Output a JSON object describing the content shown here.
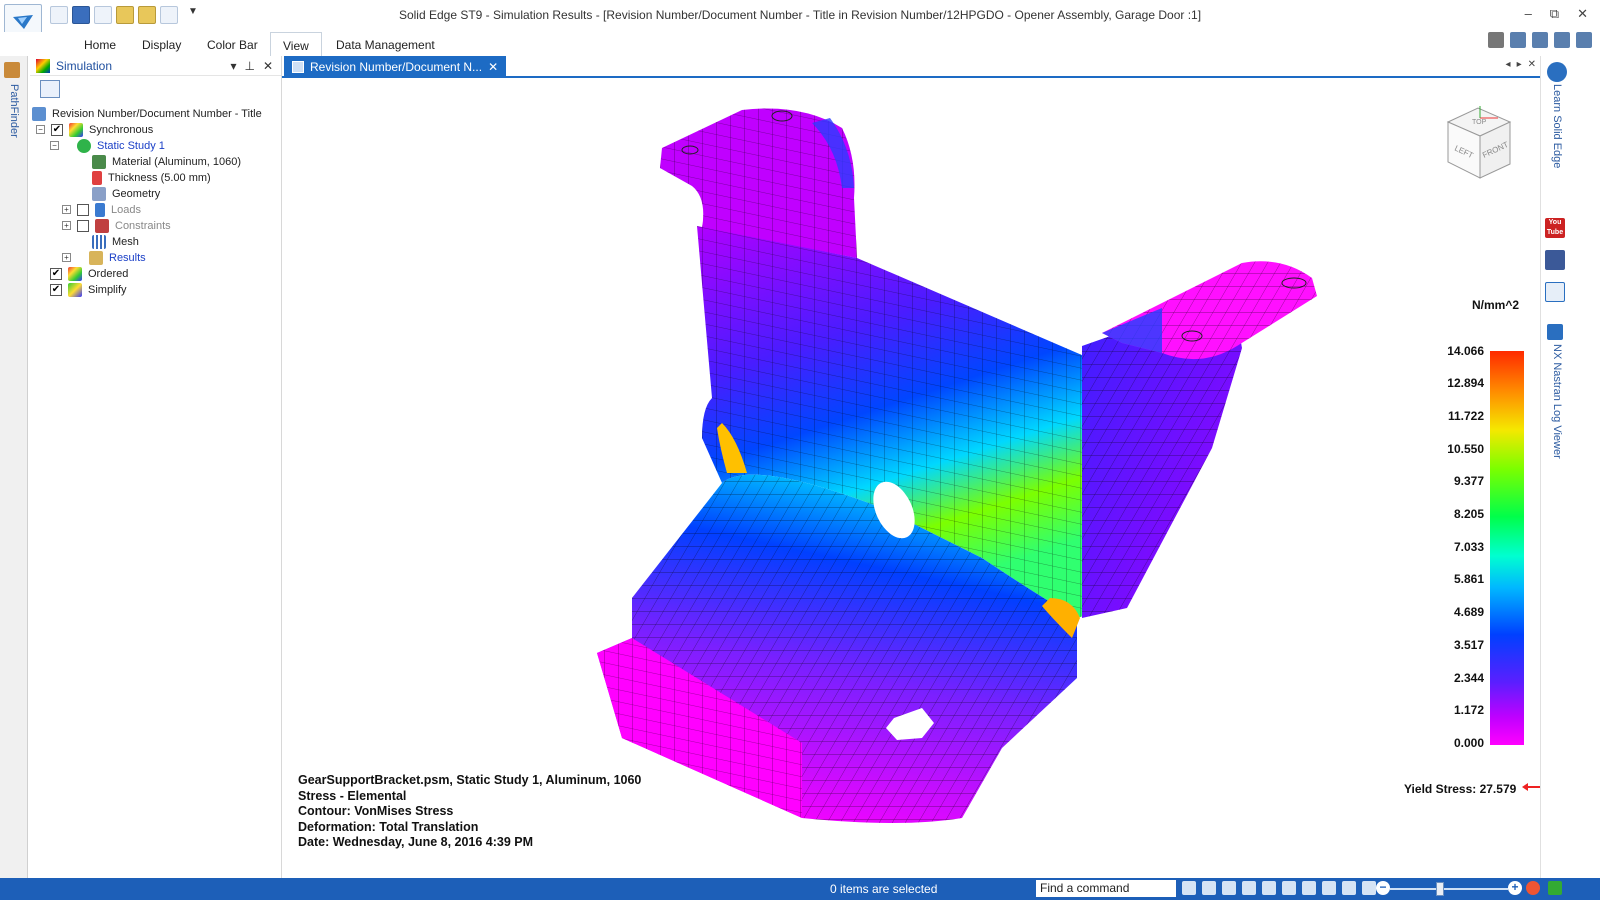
{
  "window": {
    "title": "Solid Edge ST9 - Simulation Results - [Revision Number/Document Number - Title in Revision Number/12HPGDO - Opener Assembly, Garage Door :1]",
    "controls": [
      "–",
      "⧉",
      "✕"
    ]
  },
  "ribbon": {
    "tabs": [
      "Home",
      "Display",
      "Color Bar",
      "View",
      "Data Management"
    ],
    "active_tab": "View"
  },
  "left_strip": {
    "label": "PathFinder"
  },
  "panel": {
    "title": "Simulation",
    "controls": [
      "▾",
      "⊥",
      "✕"
    ],
    "tree": [
      {
        "label": "Revision Number/Document Number - Title",
        "level": 0
      },
      {
        "label": "Synchronous",
        "level": 1,
        "checked": true,
        "expander": "−"
      },
      {
        "label": "Static Study 1",
        "level": 2,
        "style": "blue",
        "expander": "−"
      },
      {
        "label": "Material (Aluminum, 1060)",
        "level": 3
      },
      {
        "label": "Thickness (5.00 mm)",
        "level": 3
      },
      {
        "label": "Geometry",
        "level": 3
      },
      {
        "label": "Loads",
        "level": 3,
        "style": "gray",
        "expander": "+",
        "checked": false
      },
      {
        "label": "Constraints",
        "level": 3,
        "style": "gray",
        "expander": "+",
        "checked": false
      },
      {
        "label": "Mesh",
        "level": 3
      },
      {
        "label": "Results",
        "level": 3,
        "style": "blue",
        "expander": "+"
      },
      {
        "label": "Ordered",
        "level": 1,
        "checked": true
      },
      {
        "label": "Simplify",
        "level": 1,
        "checked": true
      }
    ]
  },
  "document_tab": {
    "label": "Revision Number/Document N...",
    "close": "✕",
    "controls": [
      "◂",
      "▸",
      "✕"
    ]
  },
  "view_cube": {
    "faces": [
      "TOP",
      "LEFT",
      "FRONT"
    ]
  },
  "info": {
    "line1": "GearSupportBracket.psm, Static Study 1, Aluminum, 1060",
    "line2": "Stress - Elemental",
    "line3": "Contour: VonMises Stress",
    "line4": "Deformation: Total Translation",
    "line5": "Date: Wednesday, June 8, 2016  4:39 PM"
  },
  "legend": {
    "units": "N/mm^2",
    "ticks": [
      "14.066",
      "12.894",
      "11.722",
      "10.550",
      "9.377",
      "8.205",
      "7.033",
      "5.861",
      "4.689",
      "3.517",
      "2.344",
      "1.172",
      "0.000"
    ],
    "yield": "Yield Stress: 27.579"
  },
  "right_strip": {
    "learn": "Learn Solid Edge",
    "nastran": "NX Nastran Log Viewer",
    "youtube": "You Tube"
  },
  "statusbar": {
    "selection": "0 items are selected",
    "command_placeholder": "Find a command"
  },
  "colors": {
    "accent": "#1d6bc4",
    "status": "#1d5fb8",
    "link": "#1a3fc7"
  }
}
